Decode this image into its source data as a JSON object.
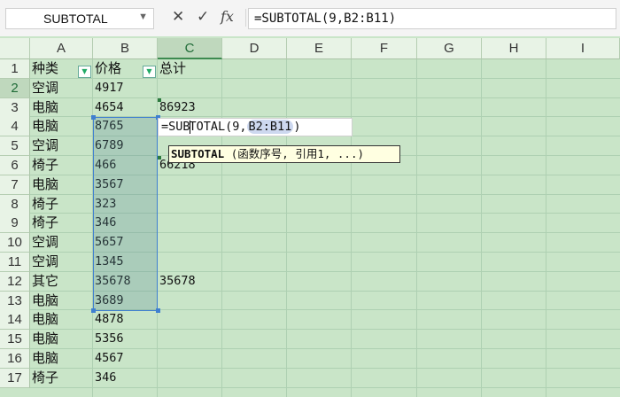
{
  "name_box": {
    "value": "SUBTOTAL",
    "dropdown_icon": "chevron-down-icon"
  },
  "formula_bar": {
    "cancel_icon": "✕",
    "enter_icon": "✓",
    "fx_label": "fx",
    "formula": "=SUBTOTAL(9,B2:B11)"
  },
  "columns": [
    "A",
    "B",
    "C",
    "D",
    "E",
    "F",
    "G",
    "H",
    "I"
  ],
  "selected_column": "C",
  "rows": [
    {
      "n": "1",
      "a": "种类",
      "b": "价格",
      "c": "总计"
    },
    {
      "n": "2",
      "a": "空调",
      "b": "4917",
      "c": ""
    },
    {
      "n": "3",
      "a": "电脑",
      "b": "4654",
      "c": "86923"
    },
    {
      "n": "4",
      "a": "电脑",
      "b": "8765",
      "c": ""
    },
    {
      "n": "5",
      "a": "空调",
      "b": "6789",
      "c": ""
    },
    {
      "n": "6",
      "a": "椅子",
      "b": "466",
      "c": "66218"
    },
    {
      "n": "7",
      "a": "电脑",
      "b": "3567",
      "c": ""
    },
    {
      "n": "8",
      "a": "椅子",
      "b": "323",
      "c": ""
    },
    {
      "n": "9",
      "a": "椅子",
      "b": "346",
      "c": ""
    },
    {
      "n": "10",
      "a": "空调",
      "b": "5657",
      "c": ""
    },
    {
      "n": "11",
      "a": "空调",
      "b": "1345",
      "c": ""
    },
    {
      "n": "12",
      "a": "其它",
      "b": "35678",
      "c": "35678"
    },
    {
      "n": "13",
      "a": "电脑",
      "b": "3689",
      "c": ""
    },
    {
      "n": "14",
      "a": "电脑",
      "b": "4878",
      "c": ""
    },
    {
      "n": "15",
      "a": "电脑",
      "b": "5356",
      "c": ""
    },
    {
      "n": "16",
      "a": "电脑",
      "b": "4567",
      "c": ""
    },
    {
      "n": "17",
      "a": "椅子",
      "b": "346",
      "c": ""
    }
  ],
  "in_cell_edit": {
    "before_caret": "=SUB",
    "after_caret": "TOTAL(9,",
    "range_ref": "B2:B11",
    "close": ")"
  },
  "tooltip": {
    "func": "SUBTOTAL",
    "args": "(函数序号, 引用1, ...)"
  },
  "colors": {
    "grid_bg": "#c9e5c8",
    "selection_border": "#3f7fd0",
    "tooltip_bg": "#ffffe1"
  }
}
